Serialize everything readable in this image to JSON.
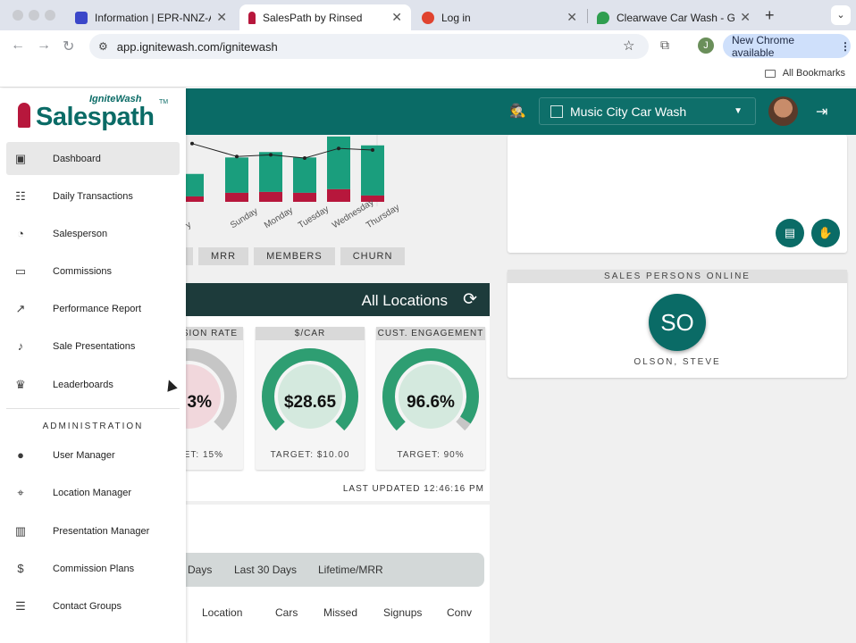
{
  "browser": {
    "tabs": [
      {
        "label": "Information | EPR-NNZ-AAAZ",
        "favicon_color": "#3b47c9"
      },
      {
        "label": "SalesPath by Rinsed",
        "favicon_color": "#b7173c",
        "active": true
      },
      {
        "label": "Log in",
        "favicon_color": "#e0432f"
      },
      {
        "label": "Clearwave Car Wash - Google",
        "favicon_color": "#2f9e4f"
      }
    ],
    "url": "app.ignitewash.com/ignitewash",
    "profile_initial": "J",
    "update_label": "New Chrome available",
    "bookmarks_label": "All Bookmarks"
  },
  "brand": {
    "top": "IgniteWash",
    "main": "Salespath",
    "tm": "TM"
  },
  "appbar": {
    "location": "Music City Car Wash"
  },
  "sidebar": {
    "items": [
      {
        "label": "Dashboard",
        "icon": "dashboard-icon"
      },
      {
        "label": "Daily Transactions",
        "icon": "daily-transactions-icon"
      },
      {
        "label": "Salesperson",
        "icon": "salesperson-icon"
      },
      {
        "label": "Commissions",
        "icon": "commissions-icon"
      },
      {
        "label": "Performance Report",
        "icon": "trending-icon"
      },
      {
        "label": "Sale Presentations",
        "icon": "presentation-icon"
      },
      {
        "label": "Leaderboards",
        "icon": "trophy-icon"
      }
    ],
    "admin_heading": "ADMINISTRATION",
    "admin_items": [
      {
        "label": "User Manager",
        "icon": "user-icon"
      },
      {
        "label": "Location Manager",
        "icon": "location-icon"
      },
      {
        "label": "Presentation Manager",
        "icon": "presentation-manager-icon"
      },
      {
        "label": "Commission Plans",
        "icon": "dollar-icon"
      },
      {
        "label": "Contact Groups",
        "icon": "contacts-icon"
      }
    ]
  },
  "chart_data": {
    "type": "bar",
    "categories": [
      "y",
      "Sunday",
      "Monday",
      "Tuesday",
      "Wednesday",
      "Thursday"
    ],
    "series": [
      {
        "values": [
          0.35,
          0.55,
          0.62,
          0.55,
          0.82,
          0.78
        ]
      },
      {
        "values": [
          0.12,
          0.2,
          0.22,
          0.2,
          0.28,
          0.14
        ]
      }
    ],
    "line": [
      0.78,
      0.62,
      0.64,
      0.6,
      0.72,
      0.7
    ]
  },
  "chips": [
    "MRR",
    "MEMBERS",
    "CHURN"
  ],
  "banner": {
    "title": "All Locations"
  },
  "kpis": [
    {
      "header": "SION RATE",
      "value": "3%",
      "target": "ET: 15%",
      "pct": 0.4,
      "color": "#c8284a"
    },
    {
      "header": "$/CAR",
      "value": "$28.65",
      "target": "TARGET: $10.00",
      "pct": 1.0,
      "color": "#2e9e72"
    },
    {
      "header": "CUST. ENGAGEMENT",
      "value": "96.6%",
      "target": "TARGET: 90%",
      "pct": 0.96,
      "color": "#2e9e72"
    }
  ],
  "last_updated": "LAST UPDATED 12:46:16 PM",
  "sales_online": {
    "heading": "SALES PERSONS ONLINE",
    "initials": "SO",
    "name": "OLSON, STEVE"
  },
  "range_tabs": [
    "Days",
    "Last 30 Days",
    "Lifetime/MRR"
  ],
  "table_headers": [
    "Location",
    "Cars",
    "Missed",
    "Signups",
    "Conv"
  ]
}
